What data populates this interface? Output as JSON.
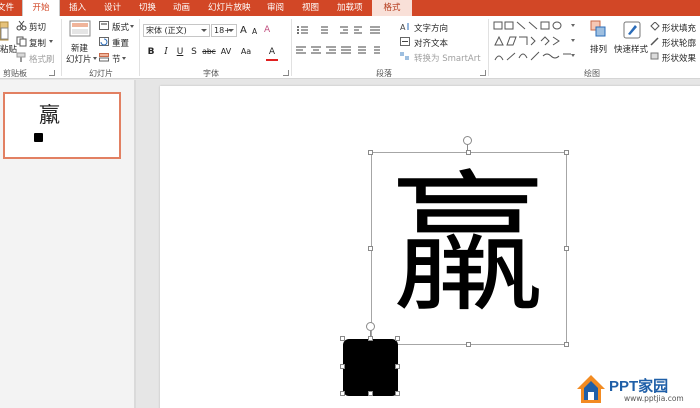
{
  "tabs": [
    "文件",
    "开始",
    "插入",
    "设计",
    "切换",
    "动画",
    "幻灯片放映",
    "审阅",
    "视图",
    "加载项",
    "格式"
  ],
  "clipboard": {
    "paste": "粘贴",
    "cut": "剪切",
    "copy": "复制",
    "format_painter": "格式刷",
    "label": "剪贴板"
  },
  "slides_group": {
    "new_slide": [
      "新建",
      "幻灯片"
    ],
    "layout": "版式",
    "reset": "重置",
    "section": "节",
    "label": "幻灯片"
  },
  "font_group": {
    "font_name": "宋体 (正文)",
    "font_size": "18+",
    "grow": "A",
    "shrink": "A",
    "clear": "A",
    "bold": "B",
    "italic": "I",
    "underline": "U",
    "shadow": "S",
    "strike": "abc",
    "spacing": "AV",
    "case": "Aa",
    "font_color": "A",
    "label": "字体"
  },
  "paragraph_group": {
    "text_direction": "文字方向",
    "align_text": "对齐文本",
    "smartart": "转换为 SmartArt",
    "label": "段落"
  },
  "drawing_group": {
    "arrange": "排列",
    "quick_styles": "快速样式",
    "shape_fill": "形状填充",
    "shape_outline": "形状轮廓",
    "shape_effects": "形状效果",
    "label": "绘图"
  },
  "thumbnail": {
    "char": "羸"
  },
  "slide": {
    "char": "羸"
  },
  "watermark": {
    "brand": "PPT家园",
    "url": "www.pptjia.com"
  },
  "colors": {
    "accent": "#d24726",
    "selected_border": "#e28062",
    "brand": "#1f5fa8"
  }
}
